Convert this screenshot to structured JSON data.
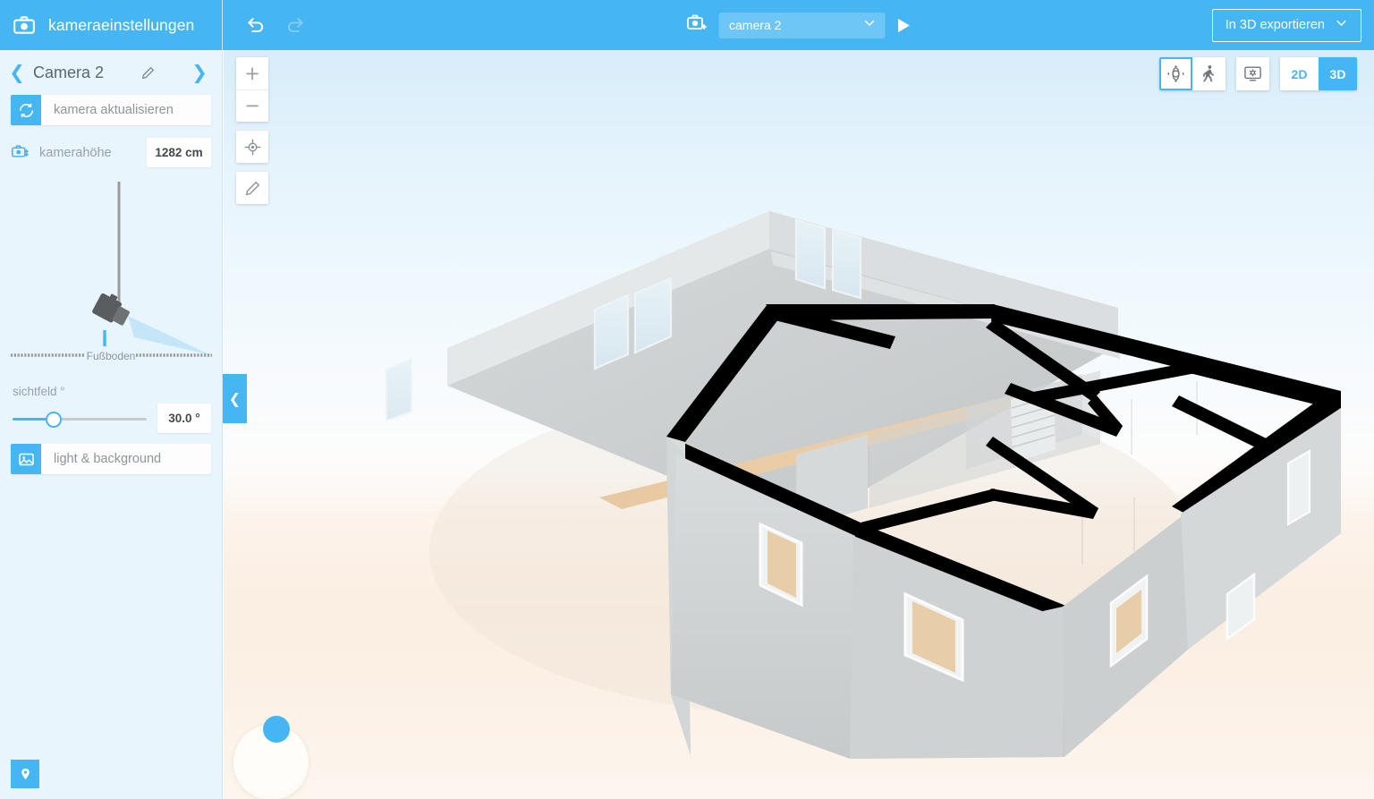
{
  "sidebar": {
    "header": {
      "title": "kameraeinstellungen",
      "icon": "camera-icon"
    },
    "nav": {
      "prev_icon": "chevron-left-icon",
      "next_icon": "chevron-right-icon",
      "edit_icon": "pencil-icon",
      "camera_name": "Camera 2"
    },
    "update_button": {
      "label": "kamera aktualisieren",
      "icon": "refresh-icon"
    },
    "height_field": {
      "label": "kamerahöhe",
      "value": "1282 cm",
      "icon": "camera-height-icon"
    },
    "diagram": {
      "floor_label": "Fußboden",
      "camera_icon": "camera-3d-icon"
    },
    "fov": {
      "label": "sichtfeld °",
      "value": "30.0 °",
      "slider_percent": 31,
      "min": 0,
      "max": 100
    },
    "light_button": {
      "label": "light & background",
      "icon": "image-icon"
    },
    "pin_button": {
      "icon": "location-pin-icon"
    },
    "collapse_tab": {
      "icon": "chevron-left-icon"
    }
  },
  "topbar": {
    "undo": {
      "icon": "undo-icon",
      "enabled": true
    },
    "redo": {
      "icon": "redo-icon",
      "enabled": false
    },
    "camera_icon": "camera-add-icon",
    "camera_select": {
      "value": "camera 2",
      "chevron": "chevron-down-icon"
    },
    "play_button": {
      "icon": "play-icon"
    },
    "export_button": {
      "label": "In 3D exportieren",
      "chevron": "chevron-down-icon"
    }
  },
  "viewport": {
    "left_tools": [
      {
        "name": "zoom-in-button",
        "glyph": "+"
      },
      {
        "name": "zoom-out-button",
        "glyph": "−"
      },
      {
        "name": "recenter-button",
        "glyph": "target-icon"
      },
      {
        "name": "edit-button",
        "glyph": "pencil-icon"
      }
    ],
    "view_modes": [
      {
        "name": "orbit-mode-button",
        "icon": "orbit-icon",
        "selected": true
      },
      {
        "name": "walkthrough-mode-button",
        "icon": "person-walk-icon",
        "selected": false
      }
    ],
    "render_settings_button": {
      "icon": "display-settings-icon"
    },
    "dimension_toggle": [
      {
        "label": "2D",
        "active": false
      },
      {
        "label": "3D",
        "active": true
      }
    ],
    "gizmo": {
      "name": "orbit-gizmo"
    }
  },
  "colors": {
    "accent": "#45b6f2",
    "sidebar_bg": "#e8f5fd",
    "sky_top": "#d7edfa",
    "ground": "#fbeee2",
    "wall_top": "#000000",
    "wall_face": "#cdd0d1",
    "floor_wood": "#e9cba4"
  }
}
